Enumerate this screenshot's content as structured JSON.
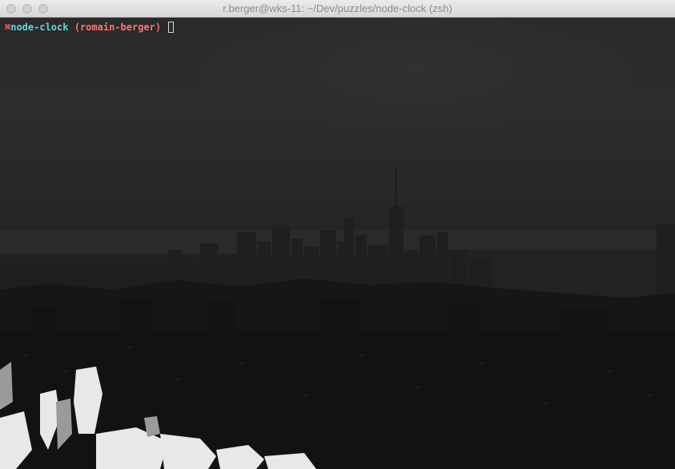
{
  "window": {
    "title": "r.berger@wks-11: ~/Dev/puzzles/node-clock (zsh)",
    "buttons": [
      "close",
      "minimize",
      "zoom"
    ]
  },
  "terminal": {
    "prompt": {
      "symbol": "⌘",
      "directory": "node-clock",
      "branch": "(romain-berger)"
    },
    "input": ""
  },
  "colors": {
    "prompt_symbol": "#ff6b6b",
    "directory": "#5fd7e0",
    "branch": "#ff7373",
    "background": "#1c1c1c",
    "title_text": "#8b8b8b"
  },
  "background_image": "dim city skyline photo"
}
